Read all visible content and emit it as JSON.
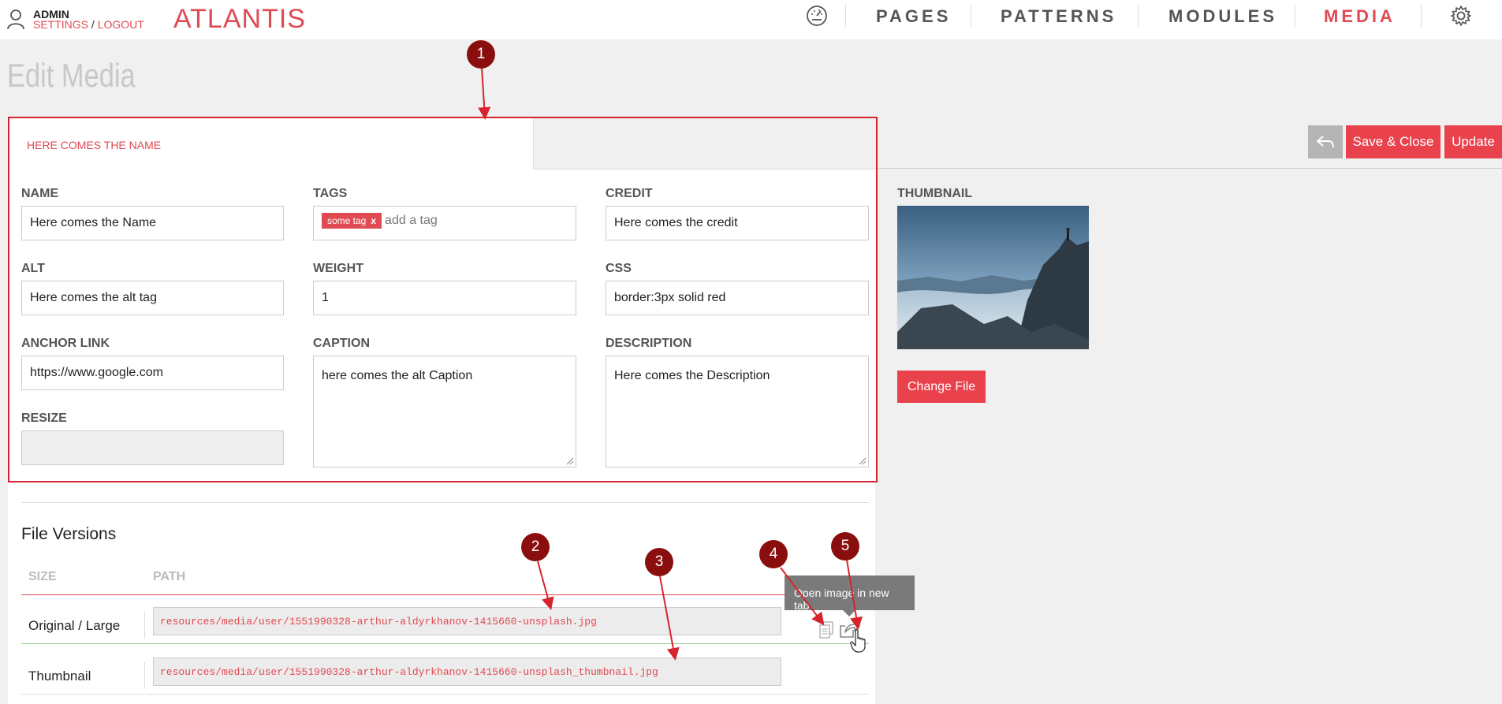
{
  "header": {
    "user_name": "ADMIN",
    "settings_link": "SETTINGS",
    "link_separator": "/",
    "logout_link": "LOGOUT",
    "brand": "ATLANTIS",
    "nav": {
      "pages": "PAGES",
      "patterns": "PATTERNS",
      "modules": "MODULES",
      "media": "MEDIA"
    },
    "active_nav": "media",
    "icons": [
      "user-icon",
      "dashboard-icon",
      "gear-icon"
    ]
  },
  "page": {
    "title": "Edit Media"
  },
  "tab": {
    "label": "HERE COMES THE NAME"
  },
  "form": {
    "name": {
      "label": "NAME",
      "value": "Here comes the Name"
    },
    "tags": {
      "label": "TAGS",
      "tag": "some tag",
      "tag_remove": "x",
      "placeholder": "add a tag"
    },
    "credit": {
      "label": "CREDIT",
      "value": "Here comes the credit"
    },
    "alt": {
      "label": "ALT",
      "value": "Here comes the alt tag"
    },
    "weight": {
      "label": "WEIGHT",
      "value": "1"
    },
    "css": {
      "label": "CSS",
      "value": "border:3px solid red"
    },
    "anchor_link": {
      "label": "ANCHOR LINK",
      "value": "https://www.google.com"
    },
    "caption": {
      "label": "CAPTION",
      "value": "here comes the alt Caption"
    },
    "description": {
      "label": "DESCRIPTION",
      "value": "Here comes the Description"
    },
    "resize": {
      "label": "RESIZE",
      "value": ""
    }
  },
  "actions": {
    "save_close": "Save & Close",
    "update": "Update",
    "change_file": "Change File"
  },
  "thumbnail": {
    "label": "THUMBNAIL"
  },
  "file_versions": {
    "title": "File Versions",
    "columns": [
      "SIZE",
      "PATH"
    ],
    "rows": [
      {
        "size": "Original / Large",
        "path": "resources/media/user/1551990328-arthur-aldyrkhanov-1415660-unsplash.jpg"
      },
      {
        "size": "Thumbnail",
        "path": "resources/media/user/1551990328-arthur-aldyrkhanov-1415660-unsplash_thumbnail.jpg"
      }
    ],
    "tooltip": "Open image in new tab"
  },
  "annotations": [
    "1",
    "2",
    "3",
    "4",
    "5"
  ],
  "colors": {
    "accent": "#e04a52",
    "highlight_border": "#d6242c",
    "marker": "#8b0e0e",
    "button": "#e9424d"
  }
}
